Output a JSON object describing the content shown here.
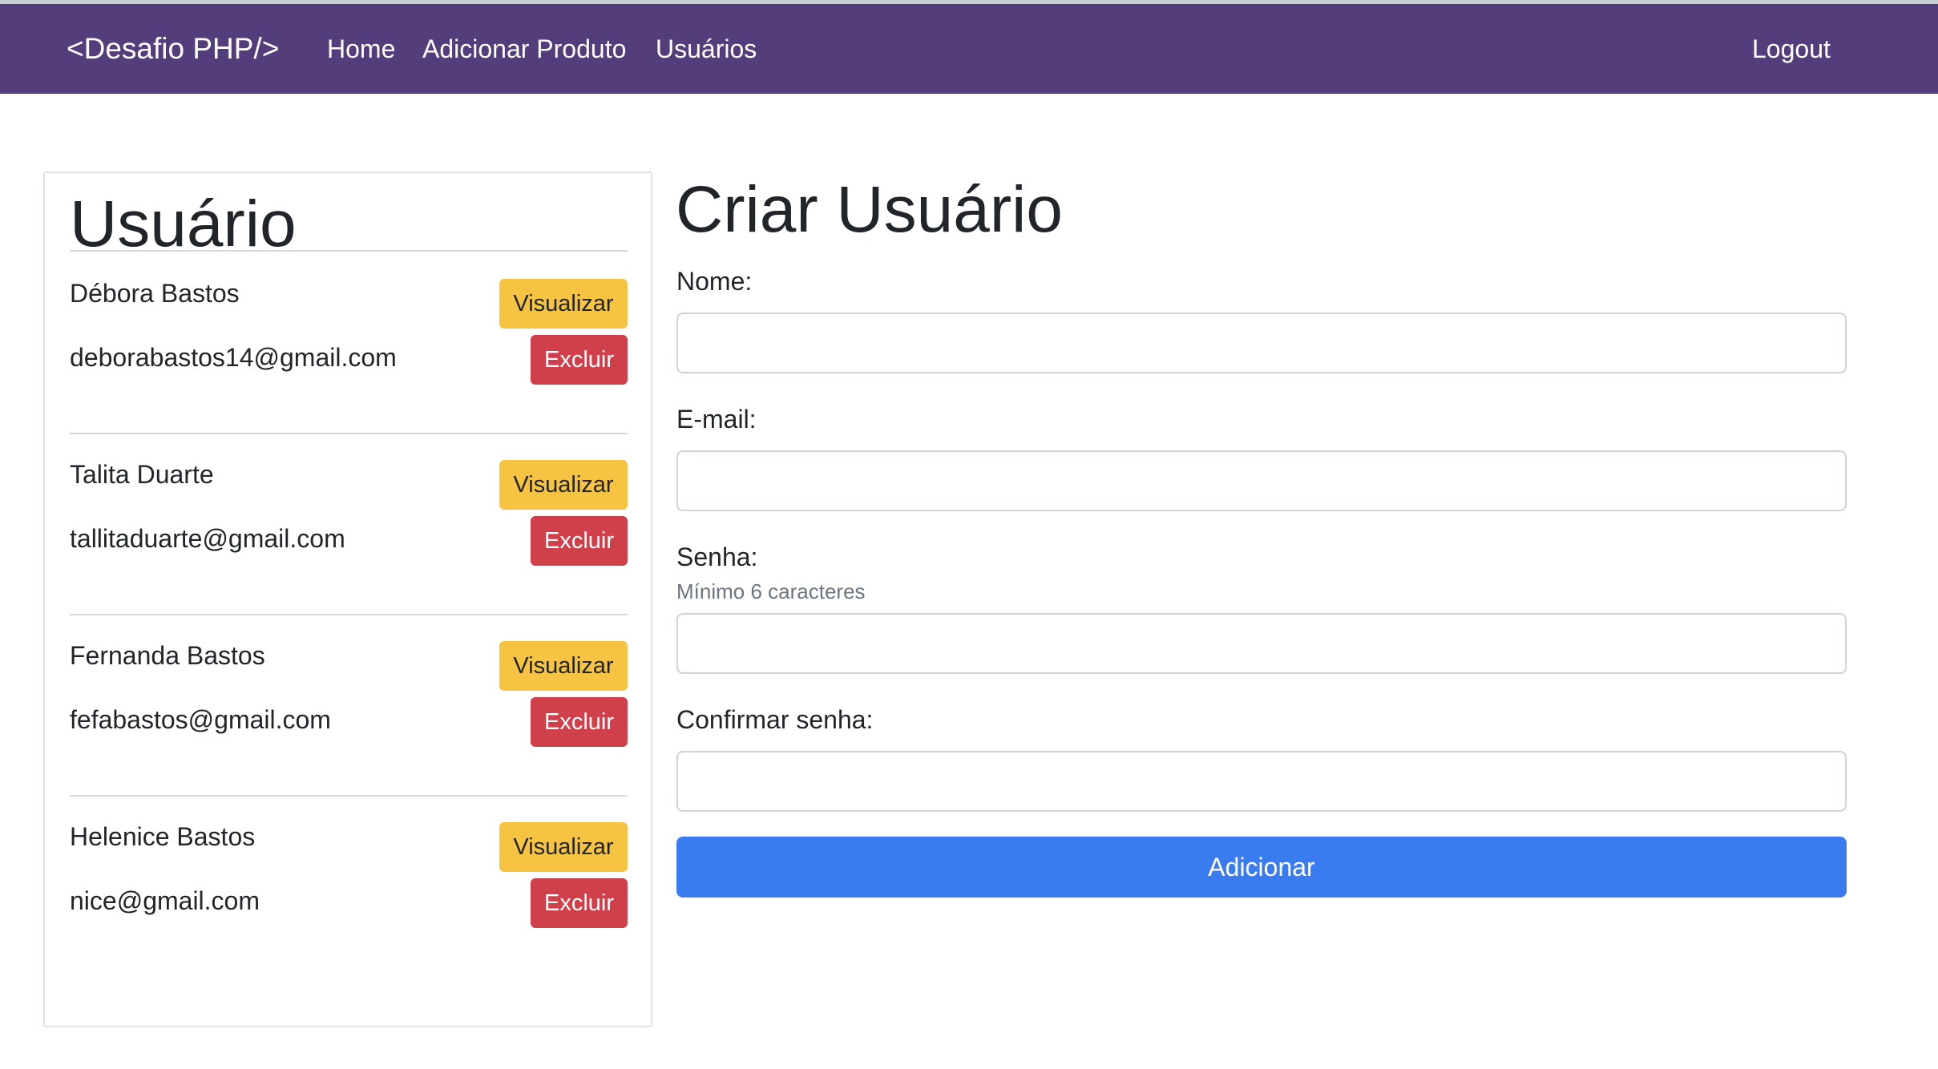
{
  "navbar": {
    "brand": "<Desafio PHP/>",
    "links": [
      "Home",
      "Adicionar Produto",
      "Usuários"
    ],
    "logout": "Logout"
  },
  "user_list": {
    "title": "Usuário",
    "view_label": "Visualizar",
    "delete_label": "Excluir",
    "users": [
      {
        "name": "Débora Bastos",
        "email": "deborabastos14@gmail.com"
      },
      {
        "name": "Talita Duarte",
        "email": "tallitaduarte@gmail.com"
      },
      {
        "name": "Fernanda Bastos",
        "email": "fefabastos@gmail.com"
      },
      {
        "name": "Helenice Bastos",
        "email": "nice@gmail.com"
      }
    ]
  },
  "form": {
    "title": "Criar Usuário",
    "name_label": "Nome:",
    "name_value": "",
    "email_label": "E-mail:",
    "email_value": "",
    "password_label": "Senha:",
    "password_help": "Mínimo 6 caracteres",
    "password_value": "",
    "confirm_label": "Confirmar senha:",
    "confirm_value": "",
    "submit_label": "Adicionar"
  },
  "colors": {
    "navbar": "#533d7a",
    "view_button": "#f6c343",
    "delete_button": "#d0404b",
    "submit_button": "#3a7bf0"
  }
}
